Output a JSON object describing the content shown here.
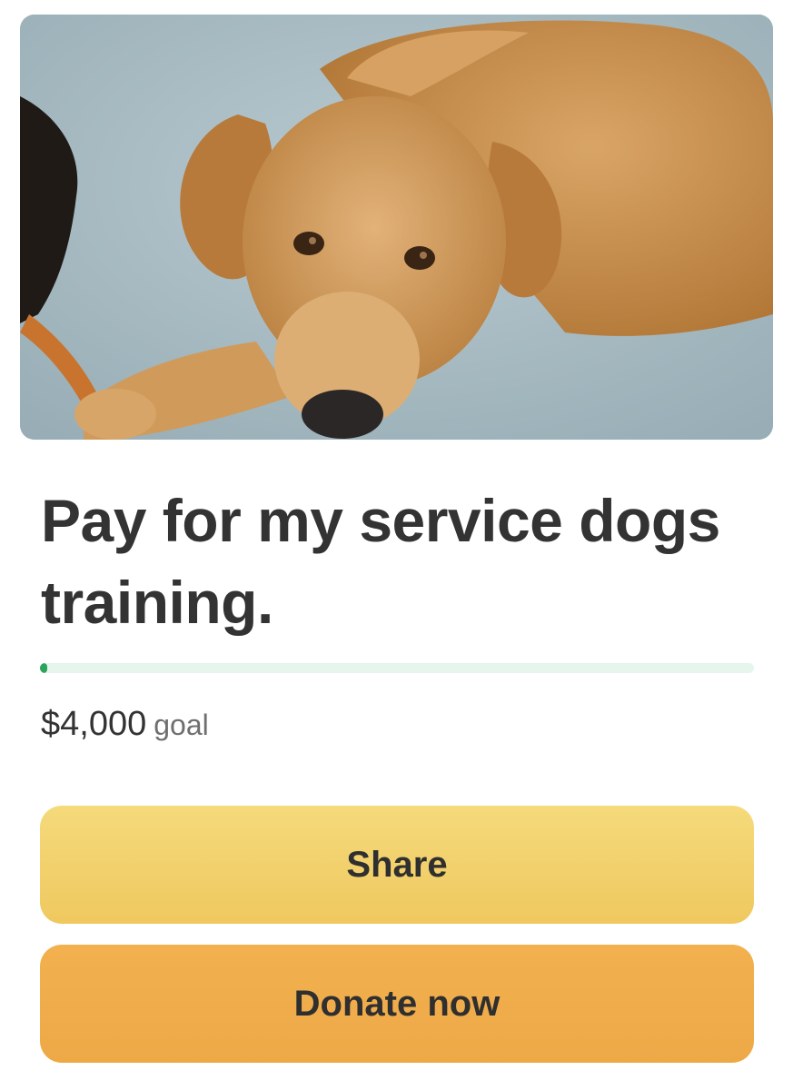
{
  "campaign": {
    "photo_alt": "",
    "title": "Pay for my service dogs training.",
    "goal_amount": "$4,000",
    "goal_label": "goal",
    "progress_fraction": 0.01
  },
  "actions": {
    "share_label": "Share",
    "donate_label": "Donate now"
  },
  "colors": {
    "progress_track": "#e6f6ec",
    "progress_fill": "#2aa55a",
    "share_button": "#f3d36f",
    "donate_button": "#efac4a",
    "text_primary": "#333333",
    "text_secondary": "#6f6f6f"
  }
}
